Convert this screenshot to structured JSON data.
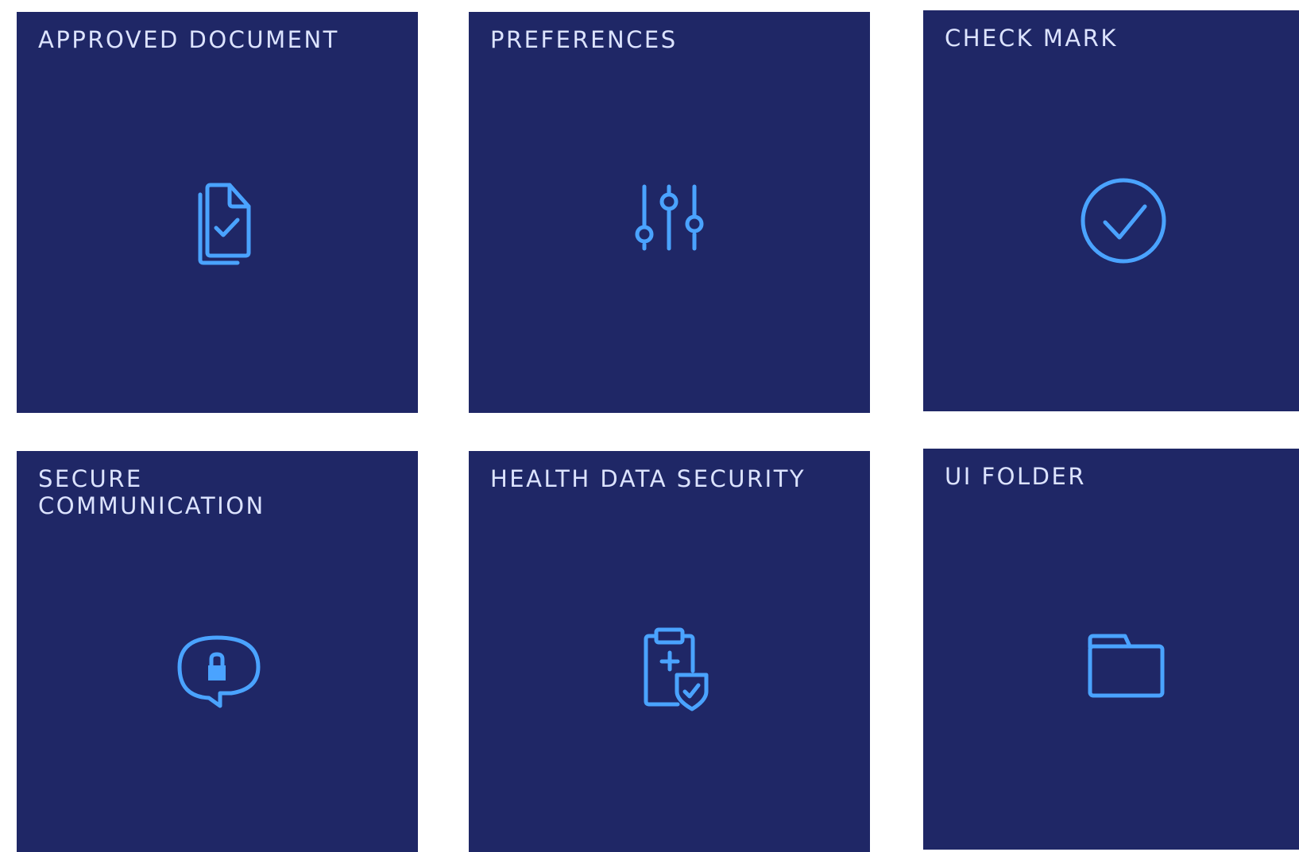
{
  "theme": {
    "tile_background": "#1f2766",
    "icon_color": "#4aa3ff",
    "title_color": "#dce3ff",
    "page_background": "#ffffff"
  },
  "tiles": [
    {
      "title": "APPROVED DOCUMENT",
      "icon": "approved-document-icon"
    },
    {
      "title": "PREFERENCES",
      "icon": "sliders-icon"
    },
    {
      "title": "CHECK MARK",
      "icon": "check-circle-icon"
    },
    {
      "title": "SECURE COMMUNICATION",
      "icon": "lock-chat-bubble-icon"
    },
    {
      "title": "HEALTH DATA SECURITY",
      "icon": "clipboard-shield-icon"
    },
    {
      "title": "UI FOLDER",
      "icon": "folder-icon"
    }
  ]
}
